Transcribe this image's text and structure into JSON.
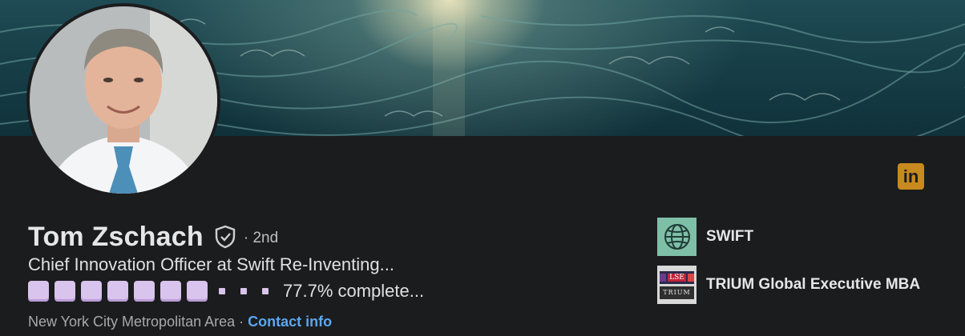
{
  "profile": {
    "name": "Tom Zschach",
    "degree": "· 2nd",
    "headline": "Chief Innovation Officer at Swift Re-Inventing...",
    "progress": {
      "filled_blocks": 7,
      "small_dots": 3,
      "percent": 77.7,
      "label": "77.7% complete..."
    },
    "location": "New York City Metropolitan Area",
    "separator": " · ",
    "contact_label": "Contact info"
  },
  "affiliations": [
    {
      "name": "SWIFT",
      "icon": "globe-icon"
    },
    {
      "name": "TRIUM Global Executive MBA",
      "icon": "trium-logo"
    }
  ],
  "icons": {
    "verify": "shield-check-icon",
    "linkedin": "linkedin-icon"
  },
  "colors": {
    "background": "#1b1c1e",
    "link": "#5aa7f0",
    "progress_block": "#d8c4ec",
    "linkedin_badge": "#c88a1f",
    "swift_logo_bg": "#7fbfa8"
  },
  "trium_logo_text": {
    "lse": "LSE",
    "trium": "TRIUM"
  }
}
